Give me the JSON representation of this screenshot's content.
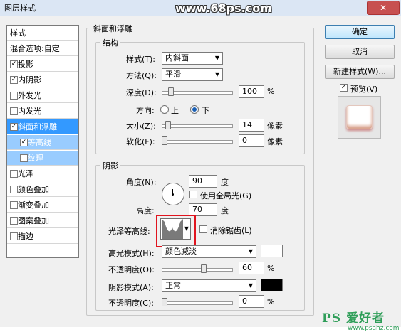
{
  "window": {
    "title": "图层样式",
    "close_symbol": "✕"
  },
  "watermark_top": "www.68ps.com",
  "style_list": {
    "items": [
      {
        "label": "样式",
        "checkbox": false,
        "checked": false,
        "state": "normal"
      },
      {
        "label": "混合选项:自定",
        "checkbox": false,
        "checked": false,
        "state": "normal"
      },
      {
        "label": "投影",
        "checkbox": true,
        "checked": true,
        "state": "normal"
      },
      {
        "label": "内阴影",
        "checkbox": true,
        "checked": true,
        "state": "normal"
      },
      {
        "label": "外发光",
        "checkbox": true,
        "checked": false,
        "state": "normal"
      },
      {
        "label": "内发光",
        "checkbox": true,
        "checked": false,
        "state": "normal"
      },
      {
        "label": "斜面和浮雕",
        "checkbox": true,
        "checked": true,
        "state": "selected"
      },
      {
        "label": "等高线",
        "checkbox": true,
        "checked": true,
        "state": "sub-selected"
      },
      {
        "label": "纹理",
        "checkbox": true,
        "checked": false,
        "state": "sub-selected"
      },
      {
        "label": "光泽",
        "checkbox": true,
        "checked": false,
        "state": "normal"
      },
      {
        "label": "颜色叠加",
        "checkbox": true,
        "checked": false,
        "state": "normal"
      },
      {
        "label": "渐变叠加",
        "checkbox": true,
        "checked": false,
        "state": "normal"
      },
      {
        "label": "图案叠加",
        "checkbox": true,
        "checked": false,
        "state": "normal"
      },
      {
        "label": "描边",
        "checkbox": true,
        "checked": false,
        "state": "normal"
      }
    ]
  },
  "panel": {
    "title": "斜面和浮雕",
    "structure": {
      "label": "结构",
      "style_label": "样式(T):",
      "style_value": "内斜面",
      "method_label": "方法(Q):",
      "method_value": "平滑",
      "depth_label": "深度(D):",
      "depth_value": "100",
      "depth_unit": "%",
      "depth_fraction": 0.1,
      "direction_label": "方向:",
      "direction_up": "上",
      "direction_down": "下",
      "direction_selected": "下",
      "size_label": "大小(Z):",
      "size_value": "14",
      "size_unit": "像素",
      "size_fraction": 0.05,
      "soften_label": "软化(F):",
      "soften_value": "0",
      "soften_unit": "像素",
      "soften_fraction": 0.0
    },
    "shading": {
      "label": "阴影",
      "angle_label": "角度(N):",
      "angle_value": "90",
      "angle_unit": "度",
      "global_light_label": "使用全局光(G)",
      "global_light_checked": false,
      "altitude_label": "高度:",
      "altitude_value": "70",
      "altitude_unit": "度",
      "gloss_contour_label": "光泽等高线:",
      "antialias_label": "消除锯齿(L)",
      "antialias_checked": false,
      "highlight_mode_label": "高光模式(H):",
      "highlight_mode_value": "颜色减淡",
      "highlight_color": "#ffffff",
      "highlight_opacity_label": "不透明度(O):",
      "highlight_opacity_value": "60",
      "highlight_opacity_unit": "%",
      "highlight_opacity_fraction": 0.6,
      "shadow_mode_label": "阴影模式(A):",
      "shadow_mode_value": "正常",
      "shadow_color": "#000000",
      "shadow_opacity_label": "不透明度(C):",
      "shadow_opacity_value": "0",
      "shadow_opacity_unit": "%",
      "shadow_opacity_fraction": 0.0
    }
  },
  "buttons": {
    "ok": "确定",
    "cancel": "取消",
    "new_style": "新建样式(W)...",
    "preview_label": "预览(V)",
    "preview_checked": true
  },
  "logo": {
    "text": "PS 爱好者",
    "url": "www.psahz.com"
  },
  "colors": {
    "selection": "#3399ff",
    "sub_selection": "#99ccff",
    "highlight_box": "#e0141e",
    "logo": "#2f9e59"
  }
}
